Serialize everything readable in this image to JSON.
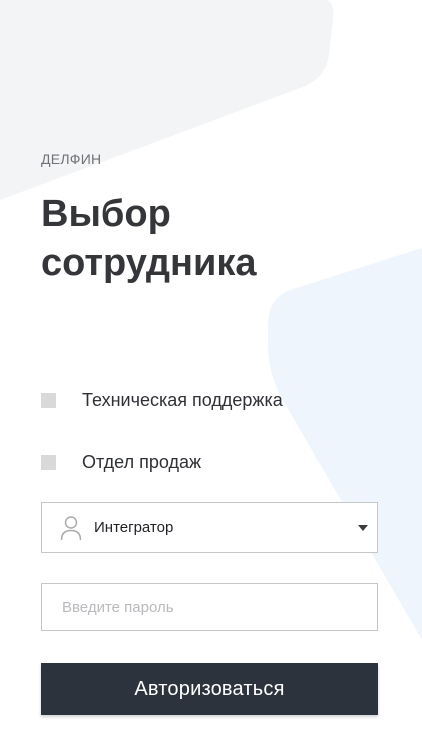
{
  "brand": {
    "company": "ДЕЛФИН"
  },
  "page": {
    "title": "Выбор сотрудника"
  },
  "options": [
    {
      "label": "Техническая поддержка",
      "checked": false
    },
    {
      "label": "Отдел продаж",
      "checked": false
    }
  ],
  "employee_select": {
    "value": "Интегратор",
    "icon": "user-icon"
  },
  "password": {
    "placeholder": "Введите пароль",
    "value": ""
  },
  "login": {
    "label": "Авторизоваться"
  },
  "colors": {
    "background": "#ffffff",
    "shape_top": "#f3f4f6",
    "shape_right": "#eef5fd",
    "button": "#2d333c",
    "checkbox": "#d9d9d9",
    "border": "#c6c6c6",
    "text": "#2f3136",
    "muted": "#6f7277",
    "placeholder": "#b8babd"
  }
}
